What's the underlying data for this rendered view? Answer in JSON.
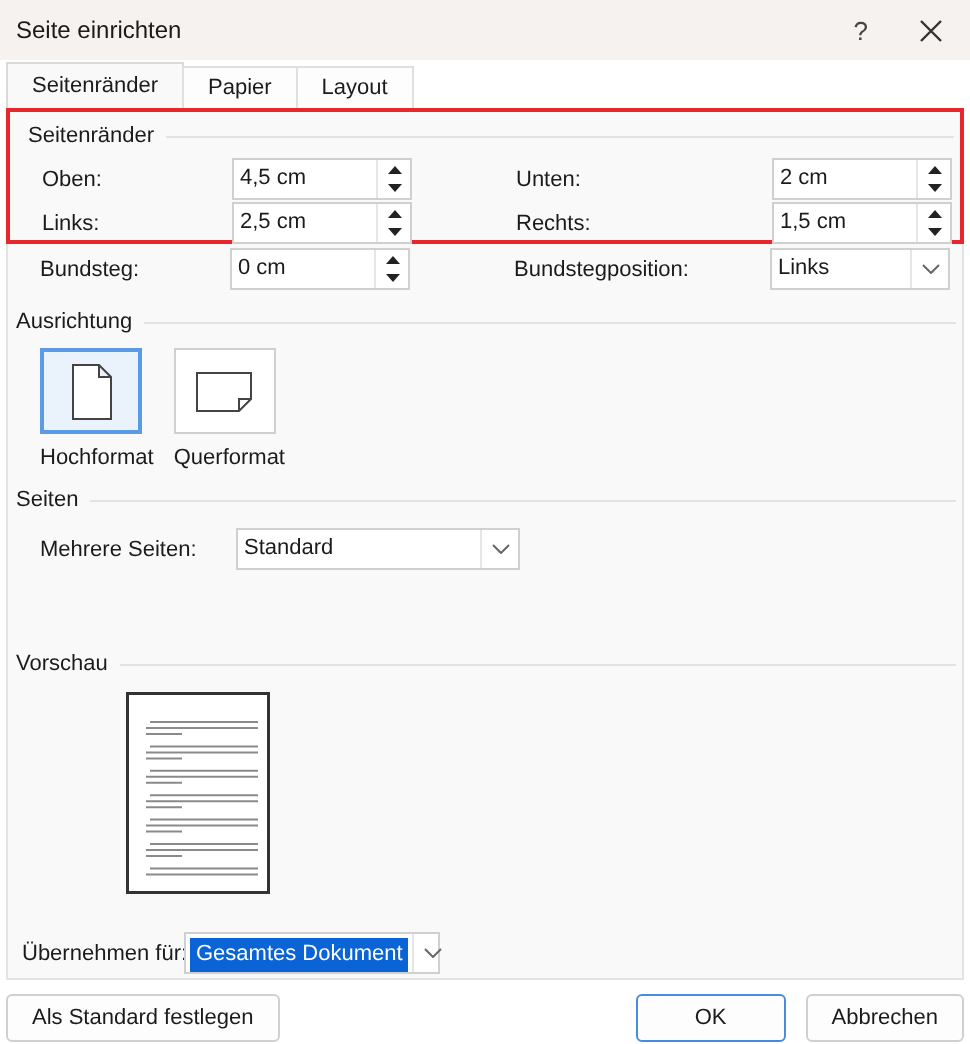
{
  "window": {
    "title": "Seite einrichten",
    "help": "?"
  },
  "tabs": [
    {
      "label": "Seitenränder",
      "selected": true
    },
    {
      "label": "Papier",
      "selected": false
    },
    {
      "label": "Layout",
      "selected": false
    }
  ],
  "margins": {
    "title": "Seitenränder",
    "highlighted": true,
    "fields": [
      {
        "label": "Oben:",
        "value": "4,5 cm"
      },
      {
        "label": "Unten:",
        "value": "2 cm"
      },
      {
        "label": "Links:",
        "value": "2,5 cm"
      },
      {
        "label": "Rechts:",
        "value": "1,5 cm"
      }
    ]
  },
  "gutter": [
    {
      "kind": "spin",
      "label": "Bundsteg:",
      "value": "0 cm"
    },
    {
      "kind": "combo",
      "label": "Bundstegposition:",
      "value": "Links"
    }
  ],
  "orientation": {
    "title": "Ausrichtung",
    "options": [
      {
        "kind": "portrait",
        "label": "Hochformat",
        "selected": true
      },
      {
        "kind": "landscape",
        "label": "Querformat",
        "selected": false
      }
    ]
  },
  "pages": {
    "title": "Seiten",
    "multiple_pages": {
      "label": "Mehrere Seiten:",
      "value": "Standard"
    }
  },
  "preview": {
    "title": "Vorschau",
    "apply_to": {
      "label": "Übernehmen für:",
      "value": "Gesamtes Dokument",
      "value_selected": true
    }
  },
  "buttons": [
    {
      "label": "Als Standard festlegen",
      "default": false
    },
    {
      "label": "OK",
      "default": true
    },
    {
      "label": "Abbrechen",
      "default": false
    }
  ]
}
